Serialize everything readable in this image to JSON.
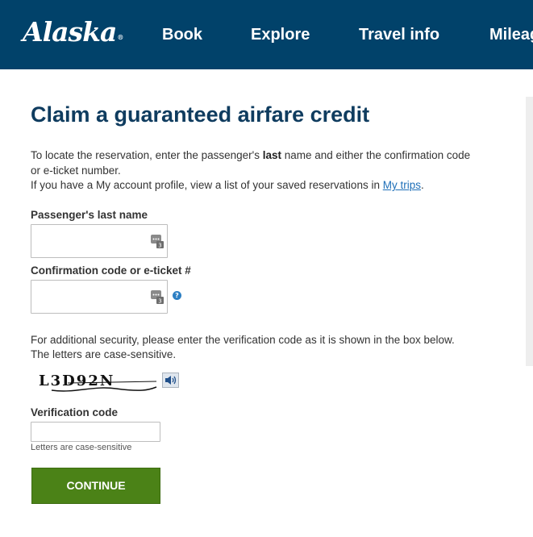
{
  "header": {
    "logo_text": "Alaska",
    "logo_mark": "®",
    "nav": [
      "Book",
      "Explore",
      "Travel info",
      "Mileage Plan"
    ]
  },
  "page": {
    "title": "Claim a guaranteed airfare credit"
  },
  "intro": {
    "line1_pre": "To locate the reservation, enter the passenger's ",
    "line1_bold": "last",
    "line1_post": " name and either the confirmation code or e-ticket number.",
    "line2_pre": "If you have a My account profile, view a list of your saved reservations in ",
    "line2_link": "My trips",
    "line2_post": "."
  },
  "form": {
    "last_name_label": "Passenger's last name",
    "last_name_value": "",
    "confirmation_label": "Confirmation code or e-ticket #",
    "confirmation_value": "",
    "help_glyph": "?",
    "security_note": "For additional security, please enter the verification code as it is shown in the box below. The letters are case-sensitive.",
    "captcha_text": "L3D92N",
    "verification_label": "Verification code",
    "verification_value": "",
    "case_hint": "Letters are case-sensitive",
    "continue_label": "CONTINUE"
  },
  "icons": {
    "keyboard": "virtual-keyboard-icon",
    "help": "help-icon",
    "audio": "speaker-icon"
  },
  "colors": {
    "header_bg": "#01426a",
    "title": "#0f3c5f",
    "link": "#1e6fb8",
    "continue_bg": "#4b8217"
  }
}
